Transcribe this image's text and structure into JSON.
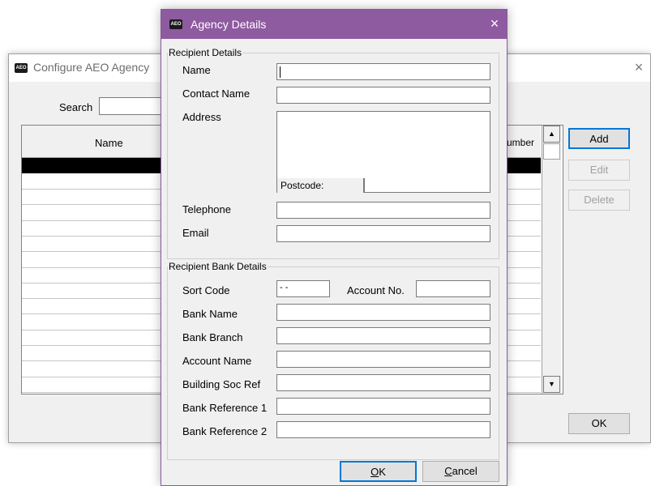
{
  "background_window": {
    "title": "Configure AEO Agency",
    "search_label": "Search",
    "columns": [
      "Name",
      "umber"
    ],
    "buttons": {
      "add": "Add",
      "edit": "Edit",
      "delete": "Delete",
      "ok": "OK"
    }
  },
  "dialog": {
    "title": "Agency Details",
    "app_icon_text": "AEO",
    "recipient_group": "Recipient Details",
    "bank_group": "Recipient Bank Details",
    "fields": {
      "name": "Name",
      "contact_name": "Contact Name",
      "address": "Address",
      "postcode": "Postcode:",
      "telephone": "Telephone",
      "email": "Email",
      "sort_code": "Sort Code",
      "sort_code_value": "- -",
      "account_no": "Account No.",
      "bank_name": "Bank Name",
      "bank_branch": "Bank Branch",
      "account_name": "Account Name",
      "building_soc_ref": "Building Soc Ref",
      "bank_reference_1": "Bank Reference 1",
      "bank_reference_2": "Bank Reference 2"
    },
    "buttons": {
      "ok_mnemonic": "O",
      "ok_rest": "K",
      "cancel_mnemonic": "C",
      "cancel_rest": "ancel"
    }
  },
  "colors": {
    "title_bar": "#8e5aa0",
    "selection": "#000000",
    "focus_border": "#0078d7"
  },
  "icons": {
    "close": "×",
    "scroll_up": "▲",
    "scroll_down": "▼"
  }
}
